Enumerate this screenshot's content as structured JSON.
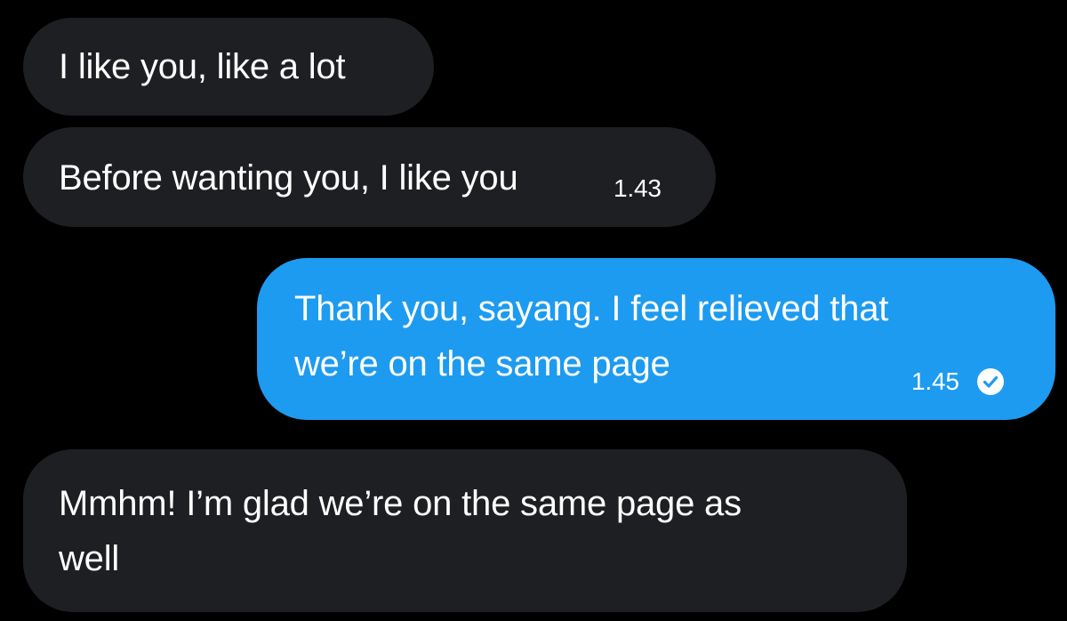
{
  "conversation": {
    "messages": [
      {
        "direction": "received",
        "lines": [
          "I like you, like a lot"
        ],
        "timestamp": ""
      },
      {
        "direction": "received",
        "lines": [
          "Before wanting you, I like you"
        ],
        "timestamp": "1.43"
      },
      {
        "direction": "sent",
        "lines": [
          "Thank you, sayang. I feel relieved that",
          "we’re on the same page"
        ],
        "timestamp": "1.45",
        "status_icon": "read-check-icon"
      },
      {
        "direction": "received",
        "lines": [
          "Mmhm! I’m glad we’re on the same page as",
          "well"
        ],
        "timestamp": ""
      }
    ]
  },
  "colors": {
    "background": "#000000",
    "received_bubble": "#1d1f22",
    "sent_bubble": "#1d9bf0",
    "text": "#ffffff"
  }
}
